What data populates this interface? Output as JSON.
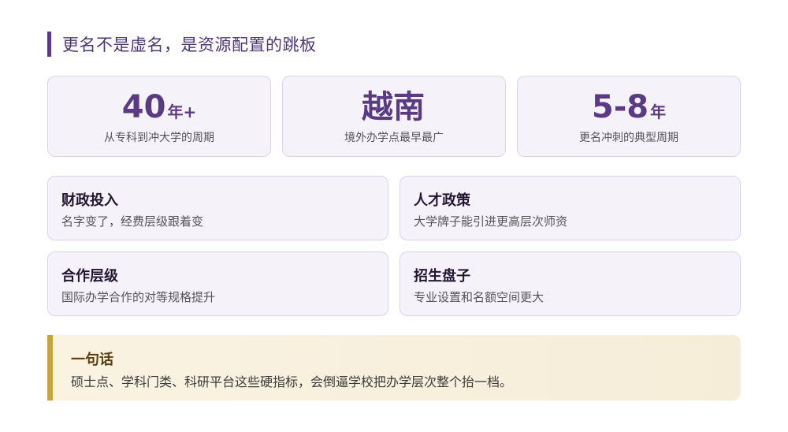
{
  "header": {
    "title": "更名不是虚名，是资源配置的跳板",
    "accent_color": "#5b3a85"
  },
  "stats": [
    {
      "value": "40",
      "unit": "年+",
      "caption": "从专科到冲大学的周期"
    },
    {
      "value": "越南",
      "unit": "",
      "caption": "境外办学点最早最广"
    },
    {
      "value": "5-8",
      "unit": "年",
      "caption": "更名冲刺的典型周期"
    }
  ],
  "features": [
    {
      "title": "财政投入",
      "desc": "名字变了，经费层级跟着变"
    },
    {
      "title": "人才政策",
      "desc": "大学牌子能引进更高层次师资"
    },
    {
      "title": "合作层级",
      "desc": "国际办学合作的对等规格提升"
    },
    {
      "title": "招生盘子",
      "desc": "专业设置和名额空间更大"
    }
  ],
  "summary": {
    "title": "一句话",
    "text": "硕士点、学科门类、科研平台这些硬指标，会倒逼学校把办学层次整个抬一档。",
    "accent_color": "#c9a43e"
  }
}
